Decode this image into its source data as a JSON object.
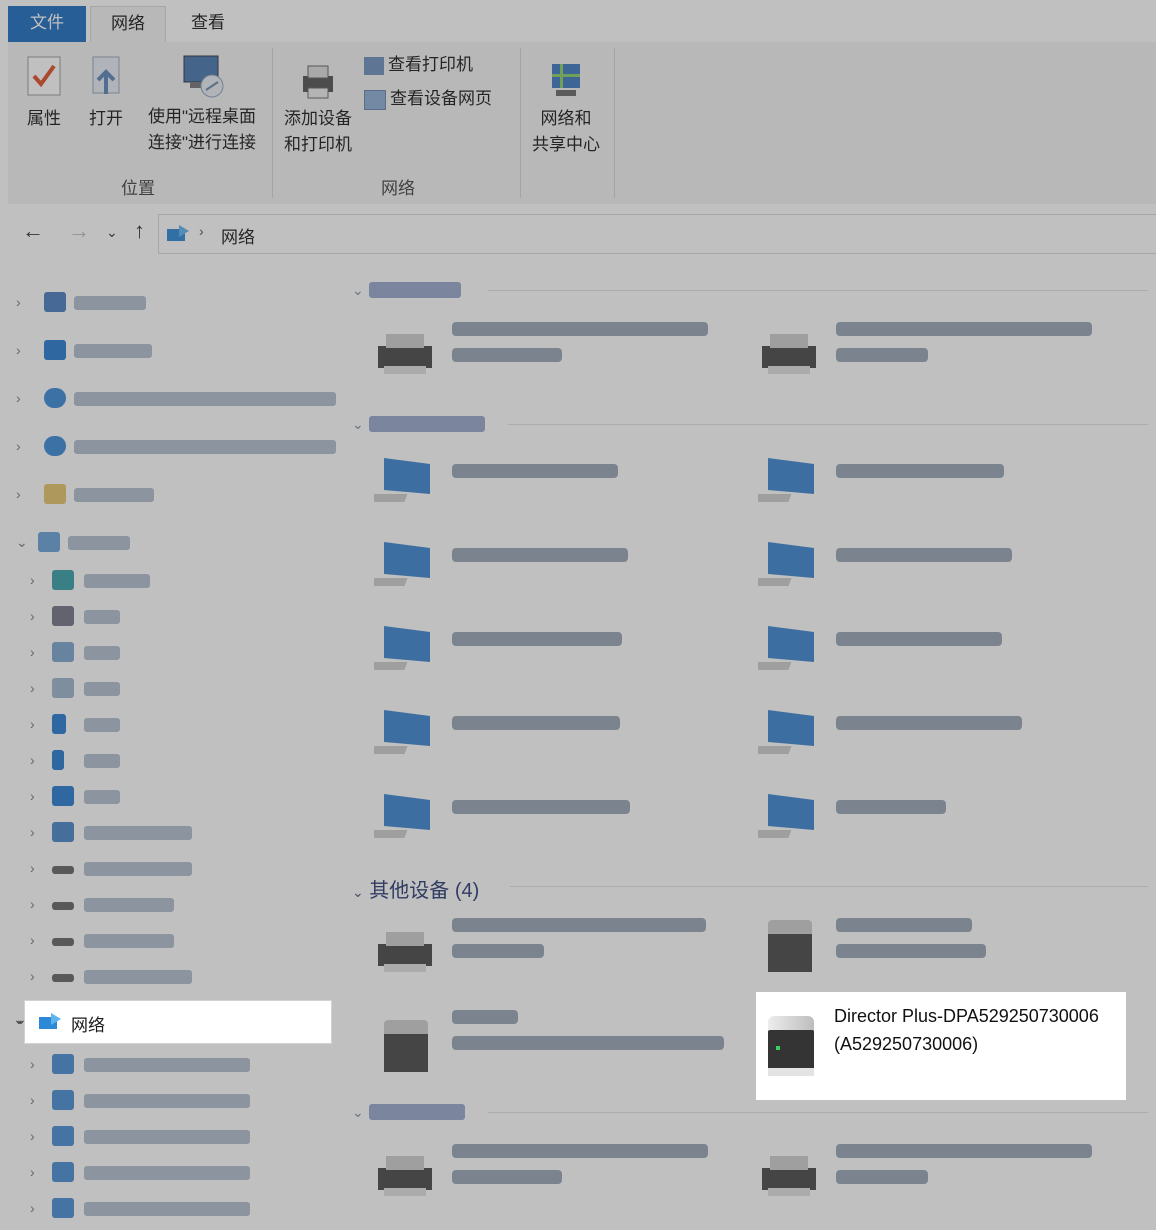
{
  "tabs": {
    "file": "文件",
    "network": "网络",
    "view": "查看"
  },
  "ribbon": {
    "properties": "属性",
    "open": "打开",
    "remote_line1": "使用\"远程桌面",
    "remote_line2": "连接\"进行连接",
    "add_device_line1": "添加设备",
    "add_device_line2": "和打印机",
    "view_printers": "查看打印机",
    "view_device_webpage": "查看设备网页",
    "sharing_center_line1": "网络和",
    "sharing_center_line2": "共享中心",
    "group_location": "位置",
    "group_network": "网络"
  },
  "address": {
    "crumb": "网络"
  },
  "nav": {
    "network_label": "网络"
  },
  "content": {
    "other_devices_title": "其他设备 (4)",
    "selected_device_line1": "Director Plus-DPA529250730006",
    "selected_device_line2": "(A529250730006)"
  },
  "colors": {
    "accent": "#1f6fc2",
    "selection": "#ffffff"
  }
}
